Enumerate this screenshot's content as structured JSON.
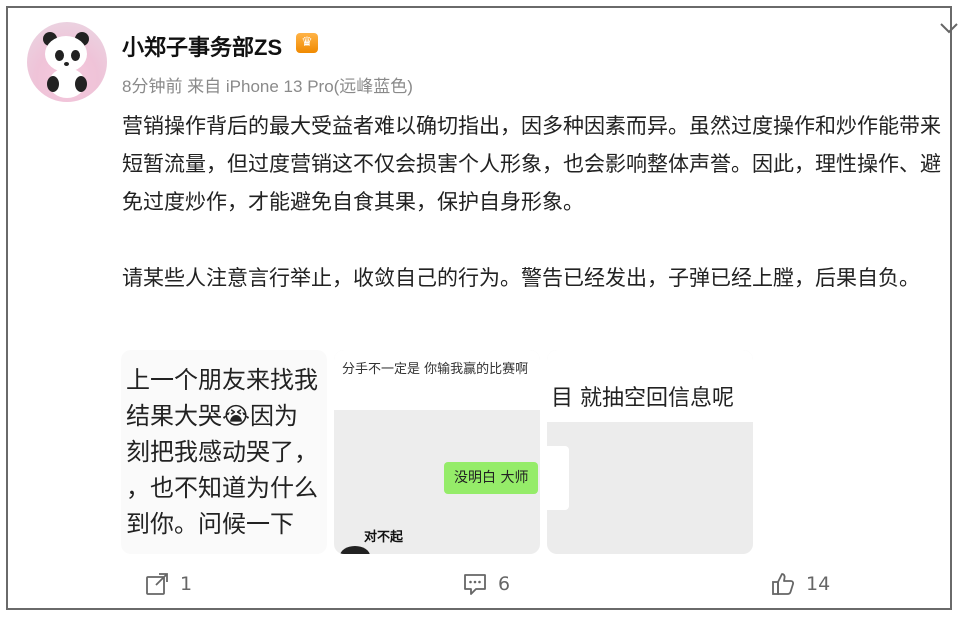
{
  "post": {
    "username": "小郑子事务部ZS",
    "badge_icon": "vip-crown-icon",
    "meta": "8分钟前 来自 iPhone 13 Pro(远峰蓝色)",
    "paragraph1": "营销操作背后的最大受益者难以确切指出，因多种因素而异。虽然过度操作和炒作能带来短暂流量，但过度营销这不仅会损害个人形象，也会影响整体声誉。因此，理性操作、避免过度炒作，才能避免自食其果，保护自身形象。",
    "paragraph2": "请某些人注意言行举止，收敛自己的行为。警告已经发出，子弹已经上膛，后果自负。"
  },
  "images": {
    "img1_lines": [
      "上一个朋友来找我",
      "结果大哭😭因为",
      "刻把我感动哭了，",
      "，也不知道为什么",
      "到你。问候一下"
    ],
    "img2_top": "分手不一定是 你输我赢的比赛啊",
    "img2_bubble": "没明白 大师",
    "img2_sticker": "对不起",
    "img3_top": "目 就抽空回信息呢"
  },
  "actions": {
    "share_count": "1",
    "comment_count": "6",
    "like_count": "14"
  }
}
